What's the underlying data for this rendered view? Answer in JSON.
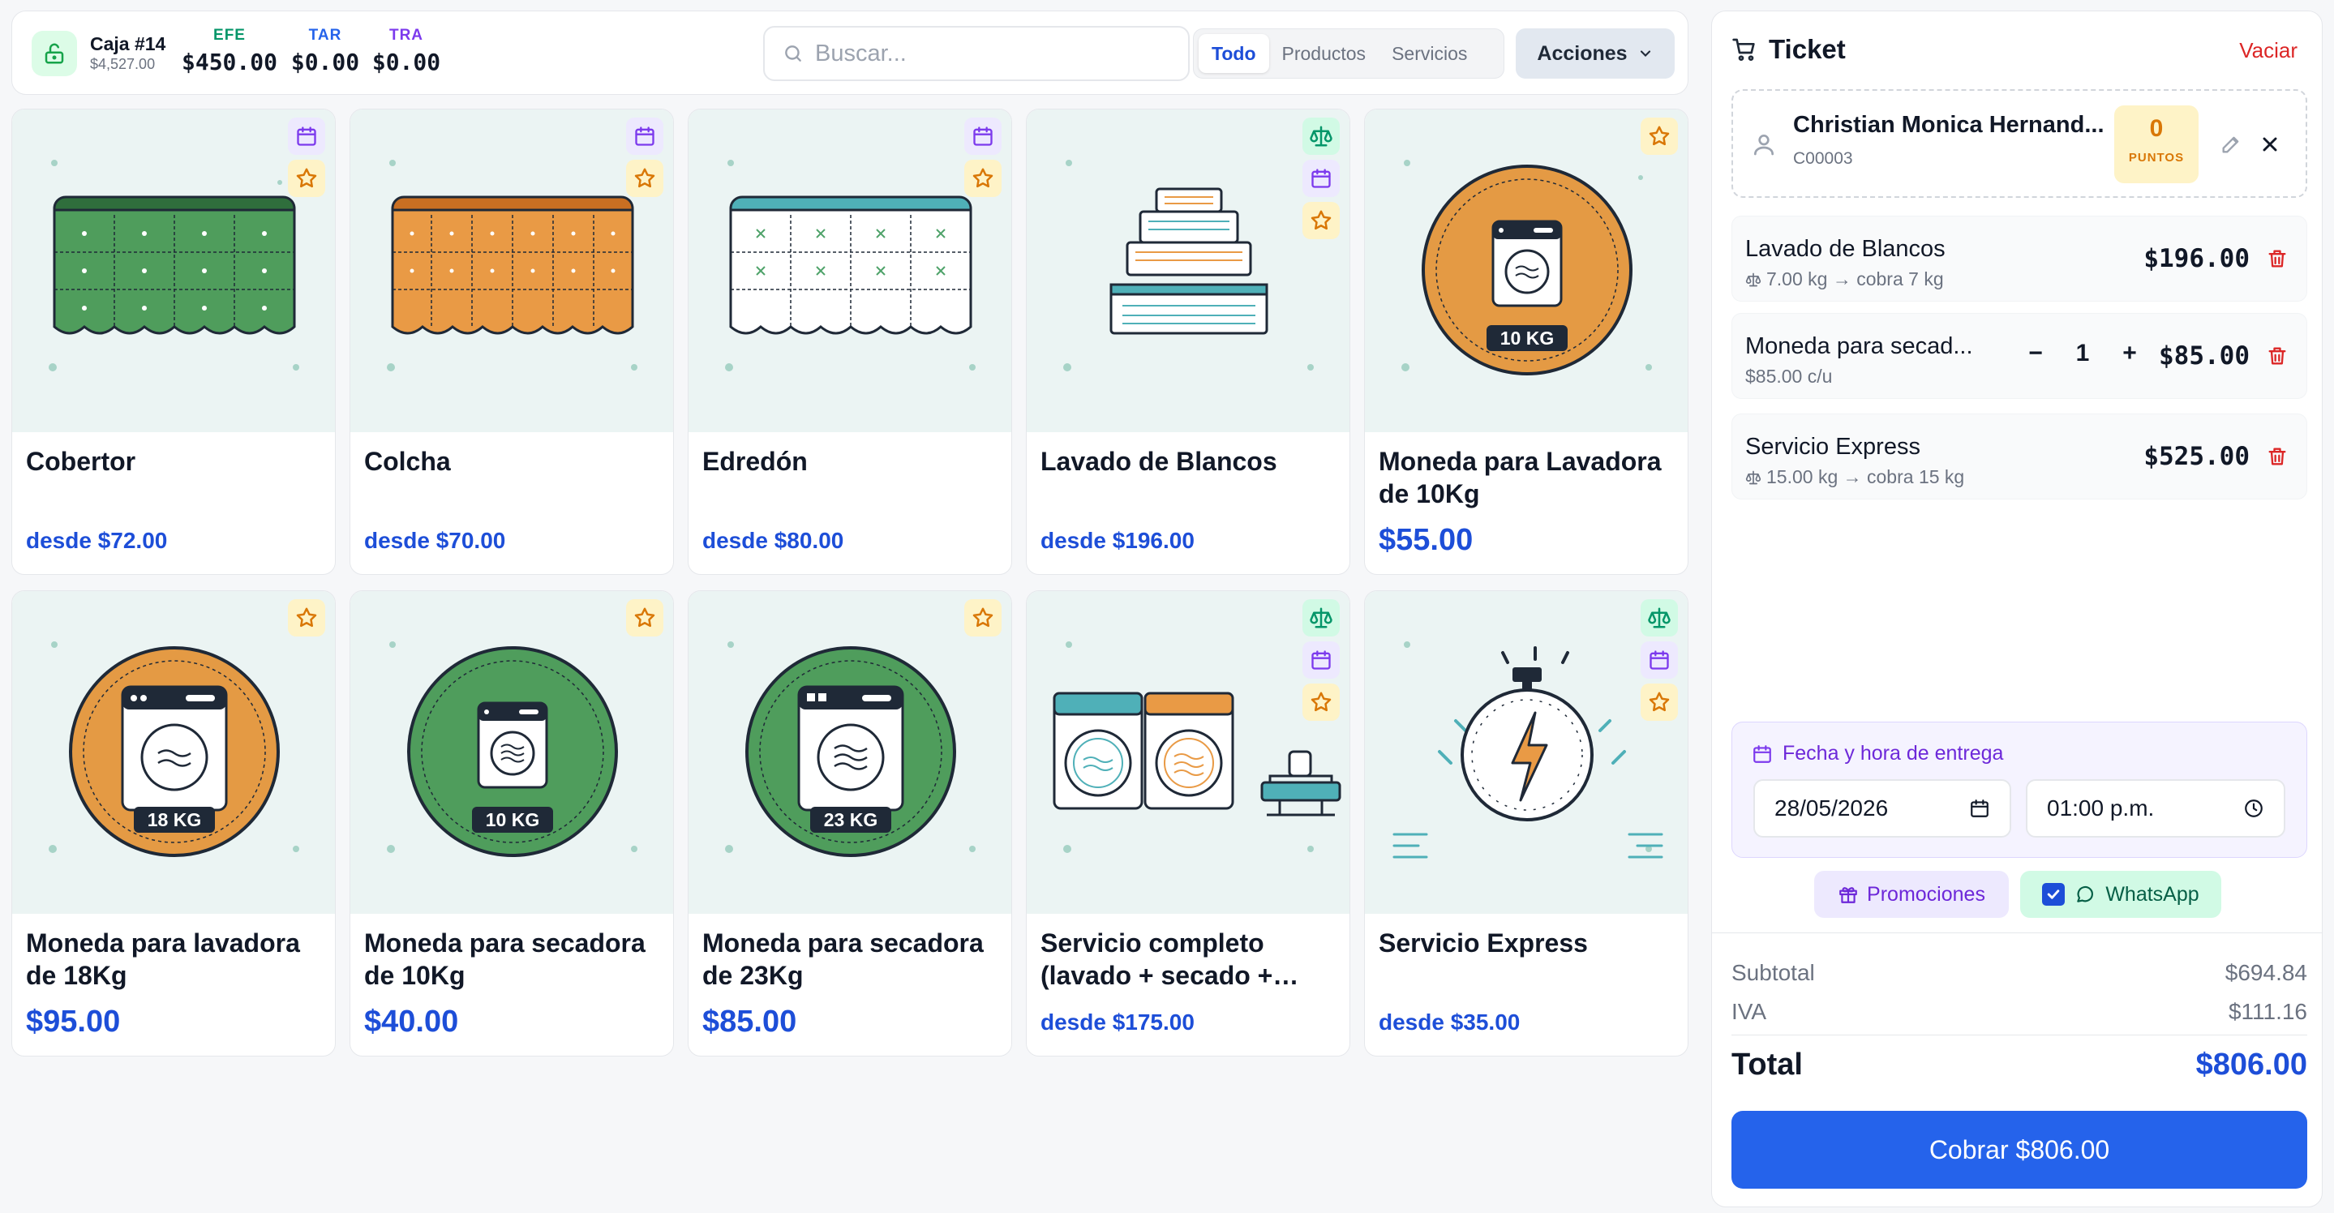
{
  "topbar": {
    "caja_title": "Caja #14",
    "caja_amount": "$4,527.00",
    "payments": [
      {
        "label": "EFE",
        "value": "$450.00",
        "color": "#059669"
      },
      {
        "label": "TAR",
        "value": "$0.00",
        "color": "#2563eb"
      },
      {
        "label": "TRA",
        "value": "$0.00",
        "color": "#7c3aed"
      }
    ],
    "search_placeholder": "Buscar...",
    "filters": [
      "Todo",
      "Productos",
      "Servicios"
    ],
    "active_filter": "Todo",
    "actions_label": "Acciones"
  },
  "products": [
    {
      "name": "Cobertor",
      "price": "desde $72.00",
      "badges": [
        "calendar-icon",
        "star-icon"
      ]
    },
    {
      "name": "Colcha",
      "price": "desde $70.00",
      "badges": [
        "calendar-icon",
        "star-icon"
      ]
    },
    {
      "name": "Edredón",
      "price": "desde $80.00",
      "badges": [
        "calendar-icon",
        "star-icon"
      ]
    },
    {
      "name": "Lavado de Blancos",
      "price": "desde $196.00",
      "badges": [
        "scale-icon",
        "calendar-icon",
        "star-icon"
      ]
    },
    {
      "name": "Moneda para Lavadora de 10Kg",
      "price": "$55.00",
      "badges": [
        "star-icon"
      ],
      "image_label": "10 KG"
    },
    {
      "name": "Moneda para lavadora de 18Kg",
      "price": "$95.00",
      "badges": [
        "star-icon"
      ],
      "image_label": "18 KG"
    },
    {
      "name": "Moneda para secadora de 10Kg",
      "price": "$40.00",
      "badges": [
        "star-icon"
      ],
      "image_label": "10 KG"
    },
    {
      "name": "Moneda para secadora de 23Kg",
      "price": "$85.00",
      "badges": [
        "star-icon"
      ],
      "image_label": "23 KG"
    },
    {
      "name": "Servicio completo (lavado + secado +…",
      "price": "desde $175.00",
      "badges": [
        "scale-icon",
        "calendar-icon",
        "star-icon"
      ]
    },
    {
      "name": "Servicio Express",
      "price": "desde $35.00",
      "badges": [
        "scale-icon",
        "calendar-icon",
        "star-icon"
      ]
    }
  ],
  "ticket": {
    "title": "Ticket",
    "clear_label": "Vaciar",
    "client": {
      "name": "Christian Monica Hernand...",
      "code": "C00003",
      "points": "0",
      "points_label": "PUNTOS"
    },
    "lines": [
      {
        "name": "Lavado de Blancos",
        "detail": "7.00 kg → cobra 7 kg",
        "price": "$196.00"
      },
      {
        "name": "Moneda para secad...",
        "detail": "$85.00 c/u",
        "qty": "1",
        "qty_minus": "−",
        "qty_plus": "+",
        "price": "$85.00"
      },
      {
        "name": "Servicio Express",
        "detail": "15.00 kg → cobra 15 kg",
        "price": "$525.00"
      }
    ],
    "delivery": {
      "label": "Fecha y hora de entrega",
      "date": "28/05/2026",
      "time": "01:00 p.m."
    },
    "promotions_label": "Promociones",
    "whatsapp_label": "WhatsApp",
    "whatsapp_checked": true,
    "subtotal_label": "Subtotal",
    "subtotal": "$694.84",
    "iva_label": "IVA",
    "iva": "$111.16",
    "total_label": "Total",
    "total": "$806.00",
    "charge_label": "Cobrar $806.00"
  },
  "colors": {
    "accent": "#2563eb",
    "danger": "#dc2626",
    "success": "#059669",
    "purple": "#7c3aed",
    "amber": "#d97706"
  }
}
